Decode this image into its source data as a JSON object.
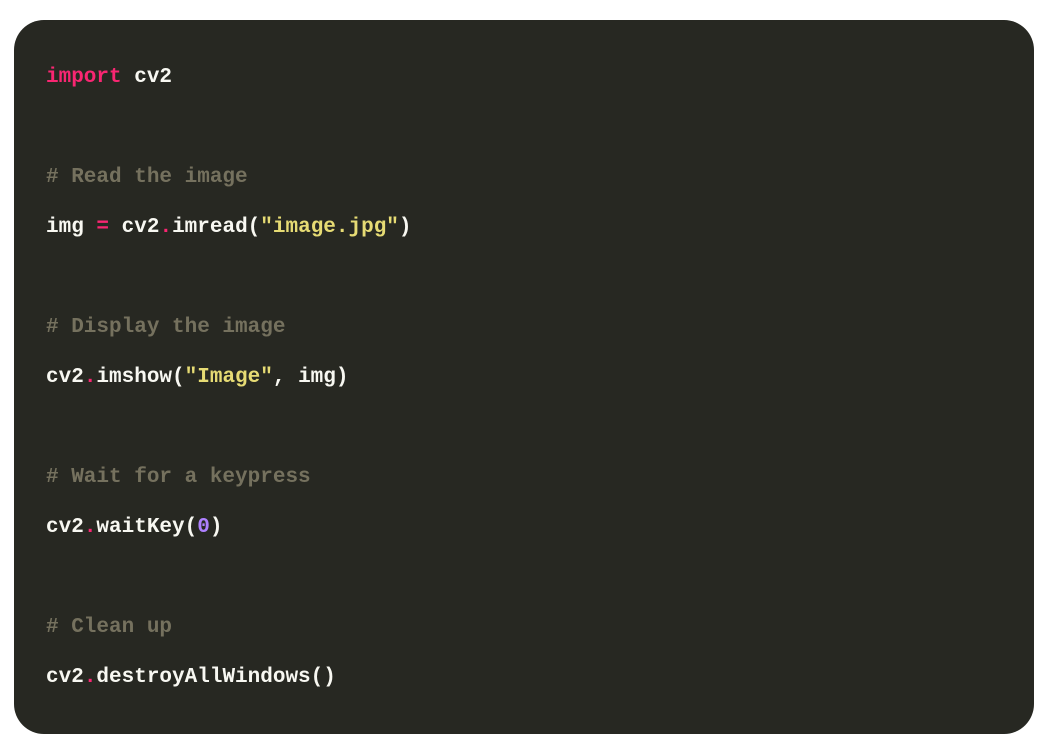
{
  "theme": {
    "background": "#272822",
    "page_background": "#ffffff",
    "keyword": "#f92672",
    "comment": "#75715e",
    "string": "#e6db74",
    "number": "#ae81ff",
    "plain": "#f8f8f2"
  },
  "code": {
    "language": "python",
    "lines": [
      {
        "tokens": [
          {
            "type": "keyword",
            "text": "import"
          },
          {
            "type": "plain",
            "text": " cv2"
          }
        ]
      },
      {
        "tokens": []
      },
      {
        "tokens": [
          {
            "type": "comment",
            "text": "# Read the image"
          }
        ]
      },
      {
        "tokens": [
          {
            "type": "plain",
            "text": "img "
          },
          {
            "type": "operator",
            "text": "="
          },
          {
            "type": "plain",
            "text": " cv2"
          },
          {
            "type": "punct-dot",
            "text": "."
          },
          {
            "type": "plain",
            "text": "imread("
          },
          {
            "type": "string",
            "text": "\"image.jpg\""
          },
          {
            "type": "plain",
            "text": ")"
          }
        ]
      },
      {
        "tokens": []
      },
      {
        "tokens": [
          {
            "type": "comment",
            "text": "# Display the image"
          }
        ]
      },
      {
        "tokens": [
          {
            "type": "plain",
            "text": "cv2"
          },
          {
            "type": "punct-dot",
            "text": "."
          },
          {
            "type": "plain",
            "text": "imshow("
          },
          {
            "type": "string",
            "text": "\"Image\""
          },
          {
            "type": "plain",
            "text": ", img)"
          }
        ]
      },
      {
        "tokens": []
      },
      {
        "tokens": [
          {
            "type": "comment",
            "text": "# Wait for a keypress"
          }
        ]
      },
      {
        "tokens": [
          {
            "type": "plain",
            "text": "cv2"
          },
          {
            "type": "punct-dot",
            "text": "."
          },
          {
            "type": "plain",
            "text": "waitKey("
          },
          {
            "type": "number",
            "text": "0"
          },
          {
            "type": "plain",
            "text": ")"
          }
        ]
      },
      {
        "tokens": []
      },
      {
        "tokens": [
          {
            "type": "comment",
            "text": "# Clean up"
          }
        ]
      },
      {
        "tokens": [
          {
            "type": "plain",
            "text": "cv2"
          },
          {
            "type": "punct-dot",
            "text": "."
          },
          {
            "type": "plain",
            "text": "destroyAllWindows()"
          }
        ]
      }
    ]
  }
}
